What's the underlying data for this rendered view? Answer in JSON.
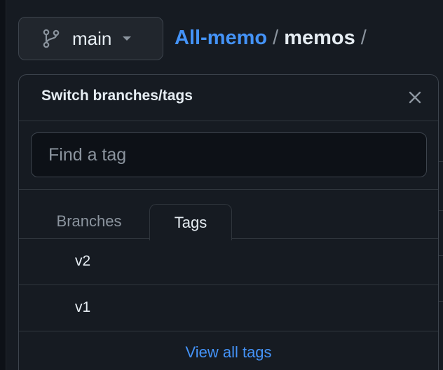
{
  "branch_button": {
    "label": "main",
    "icon": "git-branch-icon"
  },
  "breadcrumb": {
    "owner": "All-memo",
    "separator": "/",
    "repo": "memos",
    "trailing": "/"
  },
  "dropdown": {
    "title": "Switch branches/tags",
    "close_icon": "close-icon",
    "search": {
      "placeholder": "Find a tag",
      "value": ""
    },
    "tabs": [
      {
        "label": "Branches",
        "selected": false
      },
      {
        "label": "Tags",
        "selected": true
      }
    ],
    "items": [
      {
        "label": "v2"
      },
      {
        "label": "v1"
      }
    ],
    "footer_link": "View all tags"
  },
  "colors": {
    "background": "#0d1117",
    "panel": "#161b22",
    "border": "#30363d",
    "link": "#4493f8",
    "text": "#e6edf3",
    "muted": "#8b949e"
  }
}
